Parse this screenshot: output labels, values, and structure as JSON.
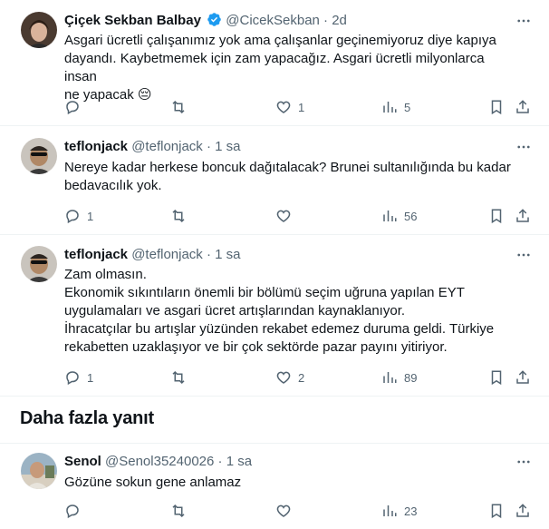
{
  "tweets": [
    {
      "name": "Çiçek Sekban Balbay",
      "handle": "@CicekSekban",
      "time": "2d",
      "verified": true,
      "lines": [
        "Asgari ücretli çalışanımız yok ama çalışanlar geçinemiyoruz diye kapıya",
        "dayandı. Kaybetmemek için zam yapacağız. Asgari ücretli milyonlarca insan",
        "ne yapacak 😔"
      ],
      "replies": "",
      "reposts": "",
      "likes": "1",
      "views": "5"
    },
    {
      "name": "teflonjack",
      "handle": "@teflonjack",
      "time": "1 sa",
      "lines": [
        "Nereye kadar herkese boncuk dağıtalacak? Brunei sultanılığında bu kadar",
        "bedavacılık yok."
      ],
      "replies": "1",
      "reposts": "",
      "likes": "",
      "views": "56"
    },
    {
      "name": "teflonjack",
      "handle": "@teflonjack",
      "time": "1 sa",
      "lines": [
        "Zam olmasın.",
        "Ekonomik sıkıntıların önemli bir bölümü seçim uğruna yapılan EYT",
        "uygulamaları ve asgari ücret artışlarından kaynaklanıyor.",
        "İhracatçılar bu artışlar yüzünden rekabet edemez duruma geldi. Türkiye",
        "rekabetten uzaklaşıyor ve bir çok sektörde pazar payını yitiriyor."
      ],
      "replies": "1",
      "reposts": "",
      "likes": "2",
      "views": "89"
    },
    {
      "name": "Senol",
      "handle": "@Senol35240026",
      "time": "1 sa",
      "lines": [
        "Gözüne sokun gene anlamaz"
      ],
      "replies": "",
      "reposts": "",
      "likes": "",
      "views": "23"
    }
  ],
  "section": {
    "more_replies": "Daha fazla yanıt"
  },
  "icons": {
    "reply": "reply-icon",
    "repost": "repost-icon",
    "like": "like-icon",
    "views": "views-icon",
    "bookmark": "bookmark-icon",
    "share": "share-icon",
    "more": "more-icon",
    "verified": "verified-badge-icon"
  },
  "colors": {
    "text": "#0f1419",
    "secondary": "#536471",
    "verified": "#1d9bf0",
    "border": "#eff3f4"
  }
}
